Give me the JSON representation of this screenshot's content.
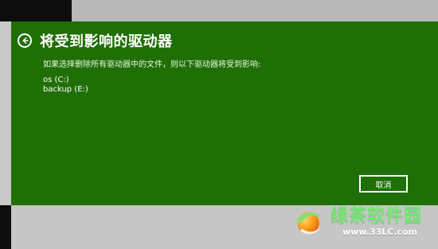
{
  "dialog": {
    "title": "将受到影响的驱动器",
    "subtitle": "如果选择删除所有驱动器中的文件，则以下驱动器将受到影响:",
    "drives": [
      "os (C:)",
      "backup (E:)"
    ],
    "cancel_label": "取消"
  },
  "icons": {
    "back": "back-arrow-icon"
  },
  "watermark": {
    "brand_text": "绿茶软件园",
    "url_text": "www.33LC.com"
  },
  "colors": {
    "dialog_green": "#1f6f06",
    "watermark_green": "#6fe86f"
  }
}
